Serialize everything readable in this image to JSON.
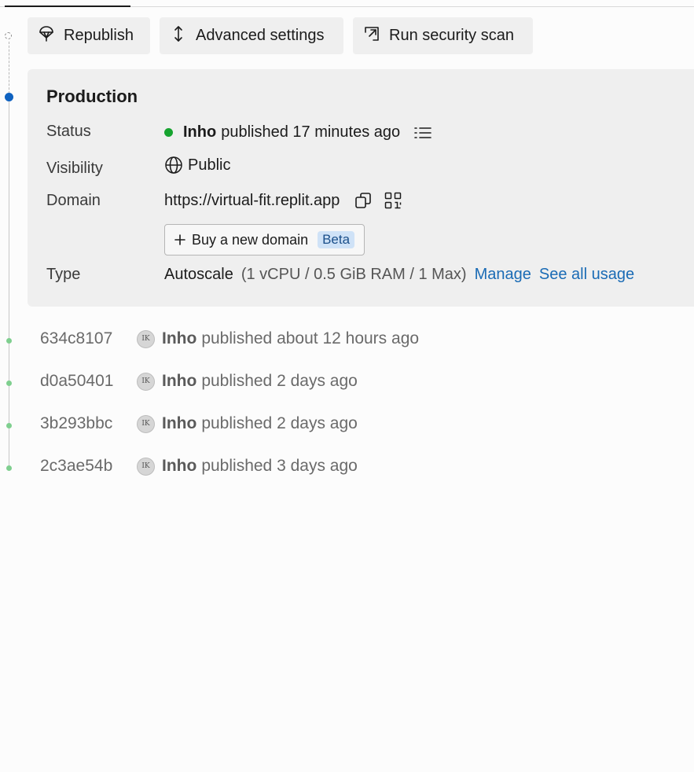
{
  "actions": {
    "republish": "Republish",
    "advanced_settings": "Advanced settings",
    "security_scan": "Run security scan"
  },
  "production": {
    "title": "Production",
    "labels": {
      "status": "Status",
      "visibility": "Visibility",
      "domain": "Domain",
      "type": "Type"
    },
    "status": {
      "author": "Inho",
      "text": "published 17 minutes ago",
      "color": "#16a32f"
    },
    "visibility": "Public",
    "domain": {
      "url": "https://virtual-fit.replit.app",
      "buy_label": "Buy a new domain",
      "beta": "Beta"
    },
    "type": {
      "name": "Autoscale",
      "spec": "(1 vCPU / 0.5 GiB RAM / 1 Max)",
      "manage": "Manage",
      "usage": "See all usage"
    }
  },
  "history": [
    {
      "hash": "634c8107",
      "initials": "IK",
      "author": "Inho",
      "text": "published about 12 hours ago"
    },
    {
      "hash": "d0a50401",
      "initials": "IK",
      "author": "Inho",
      "text": "published 2 days ago"
    },
    {
      "hash": "3b293bbc",
      "initials": "IK",
      "author": "Inho",
      "text": "published 2 days ago"
    },
    {
      "hash": "2c3ae54b",
      "initials": "IK",
      "author": "Inho",
      "text": "published 3 days ago"
    }
  ],
  "icons": {
    "republish": "republish-icon",
    "advanced": "vertical-arrows-icon",
    "scan": "external-scan-icon",
    "globe": "globe-icon",
    "list": "list-icon",
    "copy": "copy-icon",
    "qr": "qr-code-icon",
    "plus": "plus-icon"
  },
  "colors": {
    "accent": "#0f62c0",
    "link": "#1a6bb5",
    "history_node": "#7fcf8f"
  }
}
